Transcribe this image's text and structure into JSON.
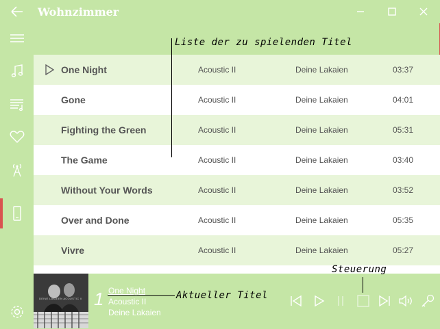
{
  "app": {
    "title": "Wohnzimmer"
  },
  "tracks": [
    {
      "title": "One Night",
      "album": "Acoustic II",
      "artist": "Deine Lakaien",
      "duration": "03:37",
      "playing": true
    },
    {
      "title": "Gone",
      "album": "Acoustic II",
      "artist": "Deine Lakaien",
      "duration": "04:01"
    },
    {
      "title": "Fighting the Green",
      "album": "Acoustic II",
      "artist": "Deine Lakaien",
      "duration": "05:31"
    },
    {
      "title": "The Game",
      "album": "Acoustic II",
      "artist": "Deine Lakaien",
      "duration": "03:40"
    },
    {
      "title": "Without Your Words",
      "album": "Acoustic II",
      "artist": "Deine Lakaien",
      "duration": "03:52"
    },
    {
      "title": "Over and Done",
      "album": "Acoustic II",
      "artist": "Deine Lakaien",
      "duration": "05:35"
    },
    {
      "title": "Vivre",
      "album": "Acoustic II",
      "artist": "Deine Lakaien",
      "duration": "05:27"
    }
  ],
  "now_playing": {
    "number": "1",
    "title": "One Night",
    "album": "Acoustic II",
    "artist": "Deine Lakaien",
    "cover_text": "DEINE LAKAIEN ACOUSTIC II"
  },
  "annotations": {
    "list": "Liste der zu spielenden Titel",
    "current": "Aktueller Titel",
    "controls": "Steuerung"
  },
  "sidebar": [
    "menu-icon",
    "music-note-icon",
    "playlist-icon",
    "heart-icon",
    "radio-tower-icon",
    "device-icon",
    "settings-icon"
  ],
  "colors": {
    "background": "#c5e6a6",
    "row_alt": "#e8f5d9",
    "accent": "#d9534f",
    "icon": "#ffffff"
  }
}
